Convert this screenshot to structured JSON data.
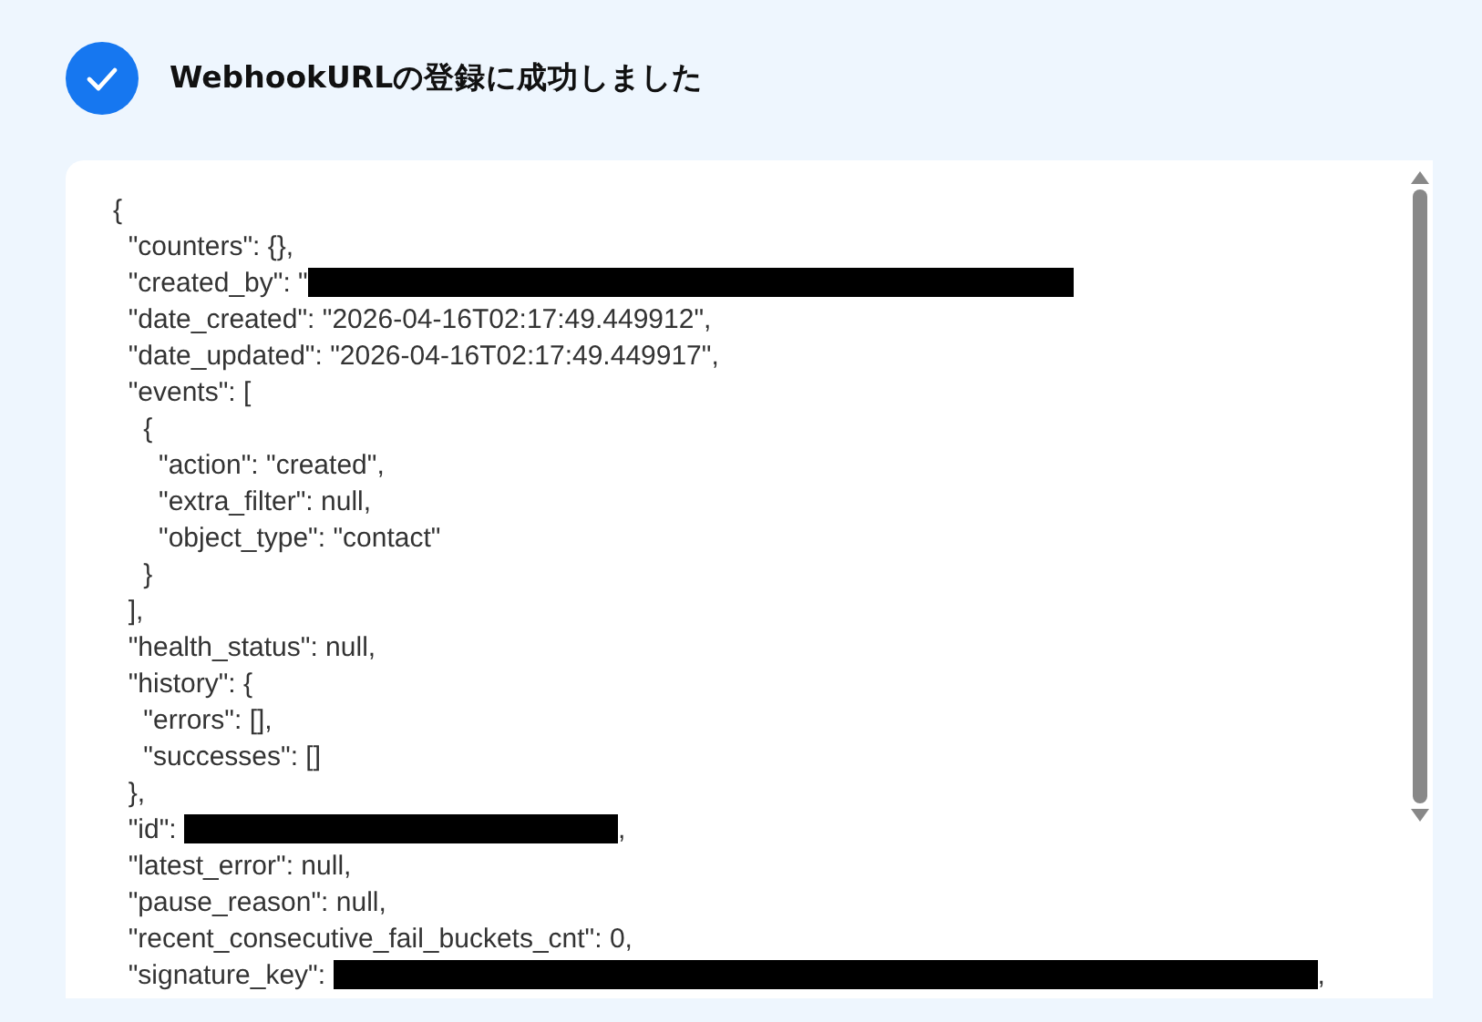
{
  "header": {
    "title": "WebhookURLの登録に成功しました"
  },
  "code_lines": [
    {
      "text": "{"
    },
    {
      "text": "  \"counters\": {},"
    },
    {
      "text": "  \"created_by\": \"",
      "redacted": true
    },
    {
      "text": "  \"date_created\": \"2026-04-16T02:17:49.449912\","
    },
    {
      "text": "  \"date_updated\": \"2026-04-16T02:17:49.449917\","
    },
    {
      "text": "  \"events\": ["
    },
    {
      "text": "    {"
    },
    {
      "text": "      \"action\": \"created\","
    },
    {
      "text": "      \"extra_filter\": null,"
    },
    {
      "text": "      \"object_type\": \"contact\""
    },
    {
      "text": "    }"
    },
    {
      "text": "  ],"
    },
    {
      "text": "  \"health_status\": null,"
    },
    {
      "text": "  \"history\": {"
    },
    {
      "text": "    \"errors\": [],"
    },
    {
      "text": "    \"successes\": []"
    },
    {
      "text": "  },"
    },
    {
      "text": "  \"id\": ",
      "redacted": true,
      "after": ","
    },
    {
      "text": "  \"latest_error\": null,"
    },
    {
      "text": "  \"pause_reason\": null,"
    },
    {
      "text": "  \"recent_consecutive_fail_buckets_cnt\": 0,"
    },
    {
      "text": "  \"signature_key\": ",
      "redacted": true,
      "after": ","
    }
  ]
}
